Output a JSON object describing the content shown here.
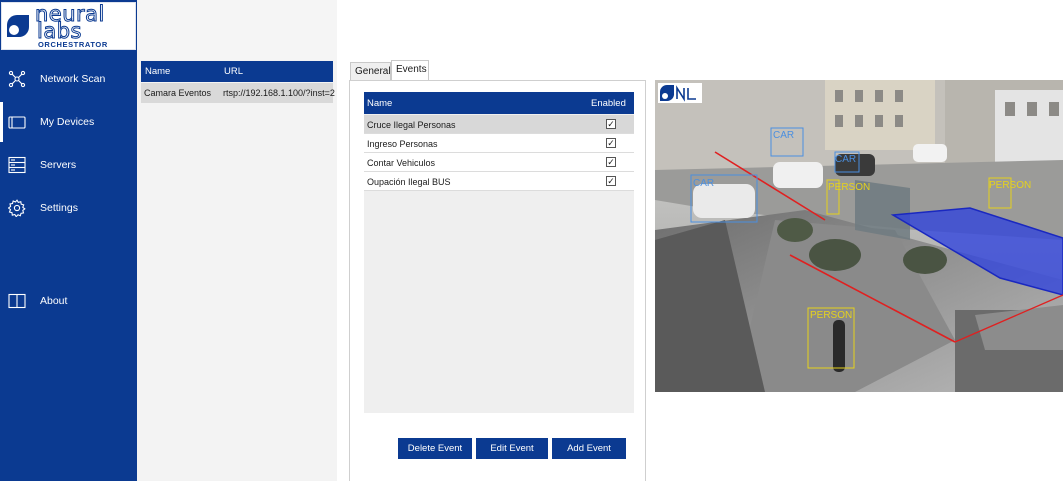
{
  "brand": {
    "name_line1": "neural",
    "name_line2": "labs",
    "subtitle": "ORCHESTRATOR"
  },
  "sidebar": {
    "items": [
      {
        "label": "Network Scan",
        "icon": "network-icon"
      },
      {
        "label": "My Devices",
        "icon": "devices-icon",
        "active": true
      },
      {
        "label": "Servers",
        "icon": "server-icon"
      },
      {
        "label": "Settings",
        "icon": "gear-icon"
      },
      {
        "label": "About",
        "icon": "book-icon"
      }
    ]
  },
  "devices": {
    "columns": [
      "Name",
      "URL"
    ],
    "rows": [
      {
        "name": "Camara Eventos",
        "url": "rtsp://192.168.1.100/?inst=2"
      }
    ]
  },
  "tabs": [
    {
      "label": "General"
    },
    {
      "label": "Events",
      "active": true
    }
  ],
  "events": {
    "columns": [
      "Name",
      "Enabled"
    ],
    "rows": [
      {
        "name": "Cruce Ilegal Personas",
        "enabled": true,
        "selected": true
      },
      {
        "name": "Ingreso Personas",
        "enabled": true
      },
      {
        "name": "Contar Vehiculos",
        "enabled": true
      },
      {
        "name": "Oupación Ilegal BUS",
        "enabled": true
      }
    ]
  },
  "buttons": {
    "delete": "Delete Event",
    "edit": "Edit Event",
    "add": "Add Event"
  },
  "camera": {
    "detections": [
      {
        "label": "CAR",
        "color": "#4a8fe0"
      },
      {
        "label": "CAR",
        "color": "#4a8fe0"
      },
      {
        "label": "CAR",
        "color": "#4a8fe0"
      },
      {
        "label": "PERSON",
        "color": "#e6d21c"
      },
      {
        "label": "PERSON",
        "color": "#e6d21c"
      },
      {
        "label": "PERSON",
        "color": "#e6d21c"
      }
    ]
  },
  "colors": {
    "brand_blue": "#0b3a91",
    "person_box": "#e6d21c",
    "car_box": "#4a8fe0",
    "zone": "#2b3fe0",
    "crossing_line": "#e02020"
  }
}
